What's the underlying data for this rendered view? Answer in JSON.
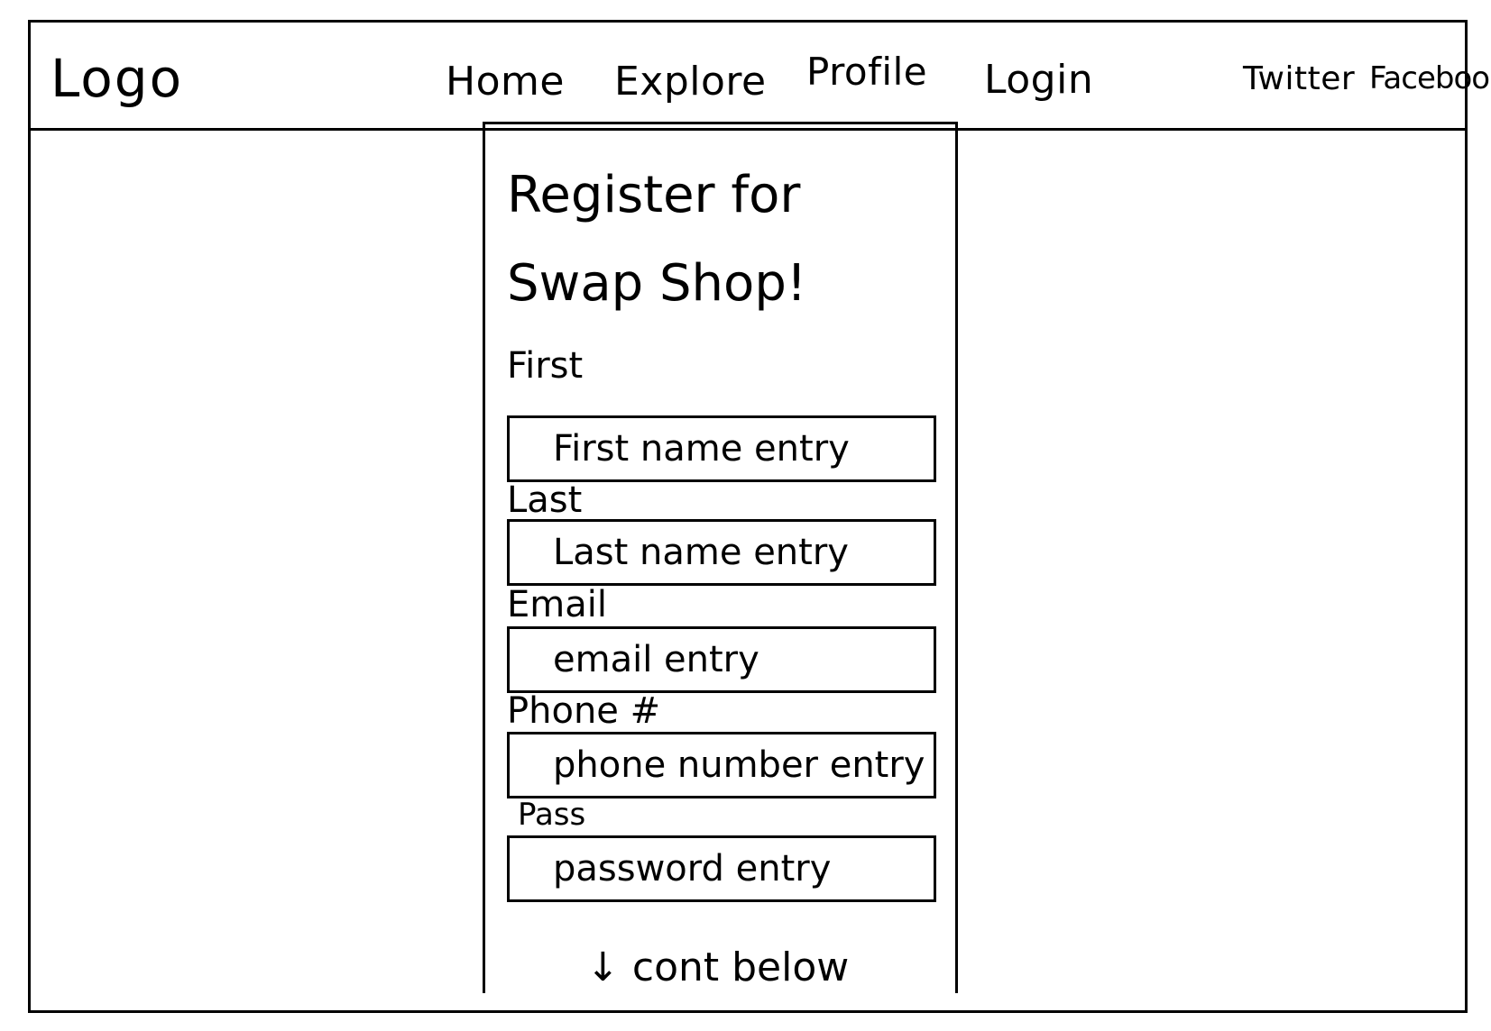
{
  "navbar": {
    "logo": "Logo",
    "links": [
      "Home",
      "Explore",
      "Profile",
      "Login"
    ],
    "social": [
      "Twitter",
      "Facebook"
    ]
  },
  "form": {
    "title": "Register for Swap Shop!",
    "fields": [
      {
        "label": "First",
        "placeholder": "First name entry"
      },
      {
        "label": "Last",
        "placeholder": "Last name entry"
      },
      {
        "label": "Email",
        "placeholder": "email entry"
      },
      {
        "label": "Phone #",
        "placeholder": "phone number entry"
      },
      {
        "label": "Pass",
        "placeholder": "password entry"
      }
    ],
    "footer_note": "cont below"
  }
}
